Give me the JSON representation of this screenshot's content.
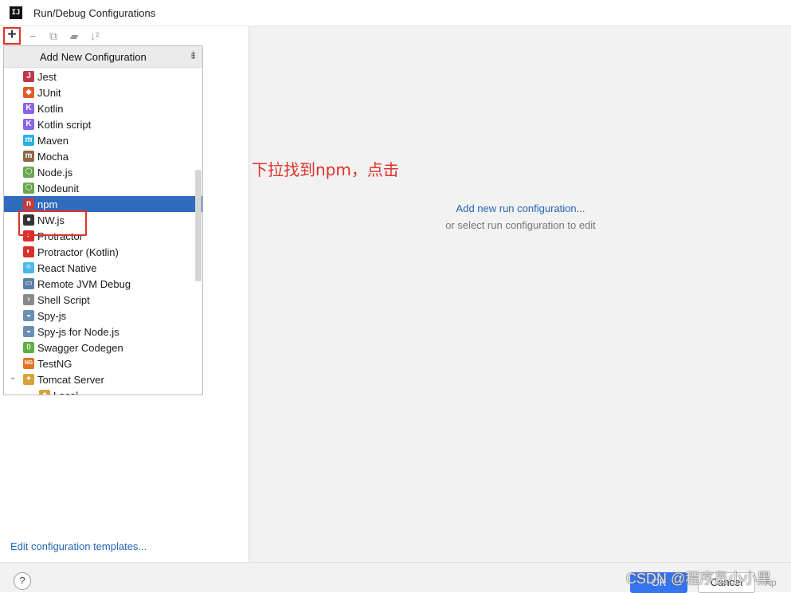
{
  "window": {
    "title": "Run/Debug Configurations",
    "app_icon": "IJ"
  },
  "toolbar": {
    "add": "+",
    "remove": "−",
    "copy": "⧉",
    "folder": "▰",
    "sort": "↓²"
  },
  "popup": {
    "title": "Add New Configuration",
    "collapse": "⇟",
    "items": [
      {
        "label": "Jest",
        "icon": "jest-icon",
        "color": "#c0364a",
        "glyph": "J"
      },
      {
        "label": "JUnit",
        "icon": "junit-icon",
        "color": "#e05c2a",
        "glyph": "◆"
      },
      {
        "label": "Kotlin",
        "icon": "kotlin-icon",
        "color": "#8a63e8",
        "glyph": "K"
      },
      {
        "label": "Kotlin script",
        "icon": "kotlin-script-icon",
        "color": "#8a63e8",
        "glyph": "K"
      },
      {
        "label": "Maven",
        "icon": "maven-icon",
        "color": "#2bb0e3",
        "glyph": "m"
      },
      {
        "label": "Mocha",
        "icon": "mocha-icon",
        "color": "#8d6748",
        "glyph": "m"
      },
      {
        "label": "Node.js",
        "icon": "nodejs-icon",
        "color": "#6aa84f",
        "glyph": "⬡"
      },
      {
        "label": "Nodeunit",
        "icon": "nodeunit-icon",
        "color": "#6aa84f",
        "glyph": "⬡"
      },
      {
        "label": "npm",
        "icon": "npm-icon",
        "color": "#cb3837",
        "glyph": "n"
      },
      {
        "label": "NW.js",
        "icon": "nwjs-icon",
        "color": "#333333",
        "glyph": "●"
      },
      {
        "label": "Protractor",
        "icon": "protractor-icon",
        "color": "#d9302c",
        "glyph": "◐"
      },
      {
        "label": "Protractor (Kotlin)",
        "icon": "protractor-kotlin-icon",
        "color": "#d9302c",
        "glyph": "◐"
      },
      {
        "label": "React Native",
        "icon": "react-native-icon",
        "color": "#4db6e6",
        "glyph": "⚛"
      },
      {
        "label": "Remote JVM Debug",
        "icon": "remote-debug-icon",
        "color": "#5b7fa8",
        "glyph": "▭"
      },
      {
        "label": "Shell Script",
        "icon": "shell-script-icon",
        "color": "#8a8a8a",
        "glyph": "›"
      },
      {
        "label": "Spy-js",
        "icon": "spyjs-icon",
        "color": "#6b8fb3",
        "glyph": "◒"
      },
      {
        "label": "Spy-js for Node.js",
        "icon": "spyjs-node-icon",
        "color": "#6b8fb3",
        "glyph": "◒"
      },
      {
        "label": "Swagger Codegen",
        "icon": "swagger-icon",
        "color": "#5fae43",
        "glyph": "{}"
      },
      {
        "label": "TestNG",
        "icon": "testng-icon",
        "color": "#e0752a",
        "glyph": "NG"
      },
      {
        "label": "Tomcat Server",
        "icon": "tomcat-icon",
        "color": "#d8a23a",
        "glyph": "✦"
      },
      {
        "label": "Local",
        "icon": "tomcat-local-icon",
        "color": "#d8a23a",
        "glyph": "✦"
      }
    ],
    "selected_index": 8
  },
  "left": {
    "edit_templates": "Edit configuration templates..."
  },
  "right": {
    "annotation": "下拉找到npm，点击",
    "add_link": "Add new run configuration...",
    "hint": "or select run configuration to edit"
  },
  "bottom": {
    "help": "?",
    "ok": "OK",
    "cancel": "Cancel",
    "apply": "Ap",
    "watermark": "CSDN @程序员小小黑"
  }
}
